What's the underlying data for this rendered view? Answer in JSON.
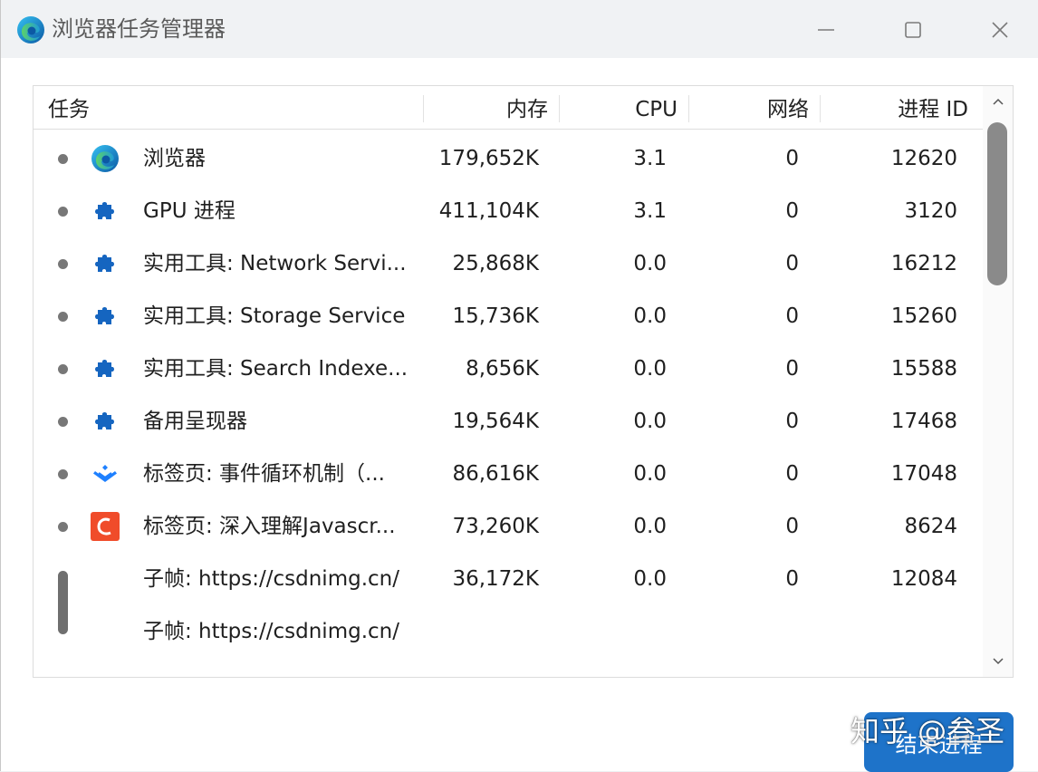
{
  "window": {
    "title": "浏览器任务管理器",
    "app_icon": "edge-browser-icon"
  },
  "columns": {
    "task": "任务",
    "memory": "内存",
    "cpu": "CPU",
    "network": "网络",
    "pid": "进程 ID"
  },
  "rows": [
    {
      "name": "浏览器",
      "icon": "edge-browser-icon",
      "memory": "179,652K",
      "cpu": "3.1",
      "network": "0",
      "pid": "12620"
    },
    {
      "name": "GPU 进程",
      "icon": "puzzle-icon",
      "memory": "411,104K",
      "cpu": "3.1",
      "network": "0",
      "pid": "3120"
    },
    {
      "name": "实用工具: Network Servi...",
      "icon": "puzzle-icon",
      "memory": "25,868K",
      "cpu": "0.0",
      "network": "0",
      "pid": "16212"
    },
    {
      "name": "实用工具: Storage Service",
      "icon": "puzzle-icon",
      "memory": "15,736K",
      "cpu": "0.0",
      "network": "0",
      "pid": "15260"
    },
    {
      "name": "实用工具: Search Indexe...",
      "icon": "puzzle-icon",
      "memory": "8,656K",
      "cpu": "0.0",
      "network": "0",
      "pid": "15588"
    },
    {
      "name": "备用呈现器",
      "icon": "puzzle-icon",
      "memory": "19,564K",
      "cpu": "0.0",
      "network": "0",
      "pid": "17468"
    },
    {
      "name": "标签页: 事件循环机制（...",
      "icon": "juejin-icon",
      "memory": "86,616K",
      "cpu": "0.0",
      "network": "0",
      "pid": "17048"
    },
    {
      "name": "标签页: 深入理解Javascr...",
      "icon": "csdn-icon",
      "memory": "73,260K",
      "cpu": "0.0",
      "network": "0",
      "pid": "8624"
    },
    {
      "name": "子帧: https://csdnimg.cn/",
      "icon": "",
      "memory": "36,172K",
      "cpu": "0.0",
      "network": "0",
      "pid": "12084"
    },
    {
      "name": "子帧: https://csdnimg.cn/",
      "icon": "",
      "memory": "",
      "cpu": "",
      "network": "",
      "pid": ""
    }
  ],
  "buttons": {
    "end_process": "结束进程"
  },
  "watermark": "知乎 @叁圣",
  "colors": {
    "accent": "#1e73c9",
    "puzzle": "#1565c0",
    "csdn": "#f04c2a"
  }
}
